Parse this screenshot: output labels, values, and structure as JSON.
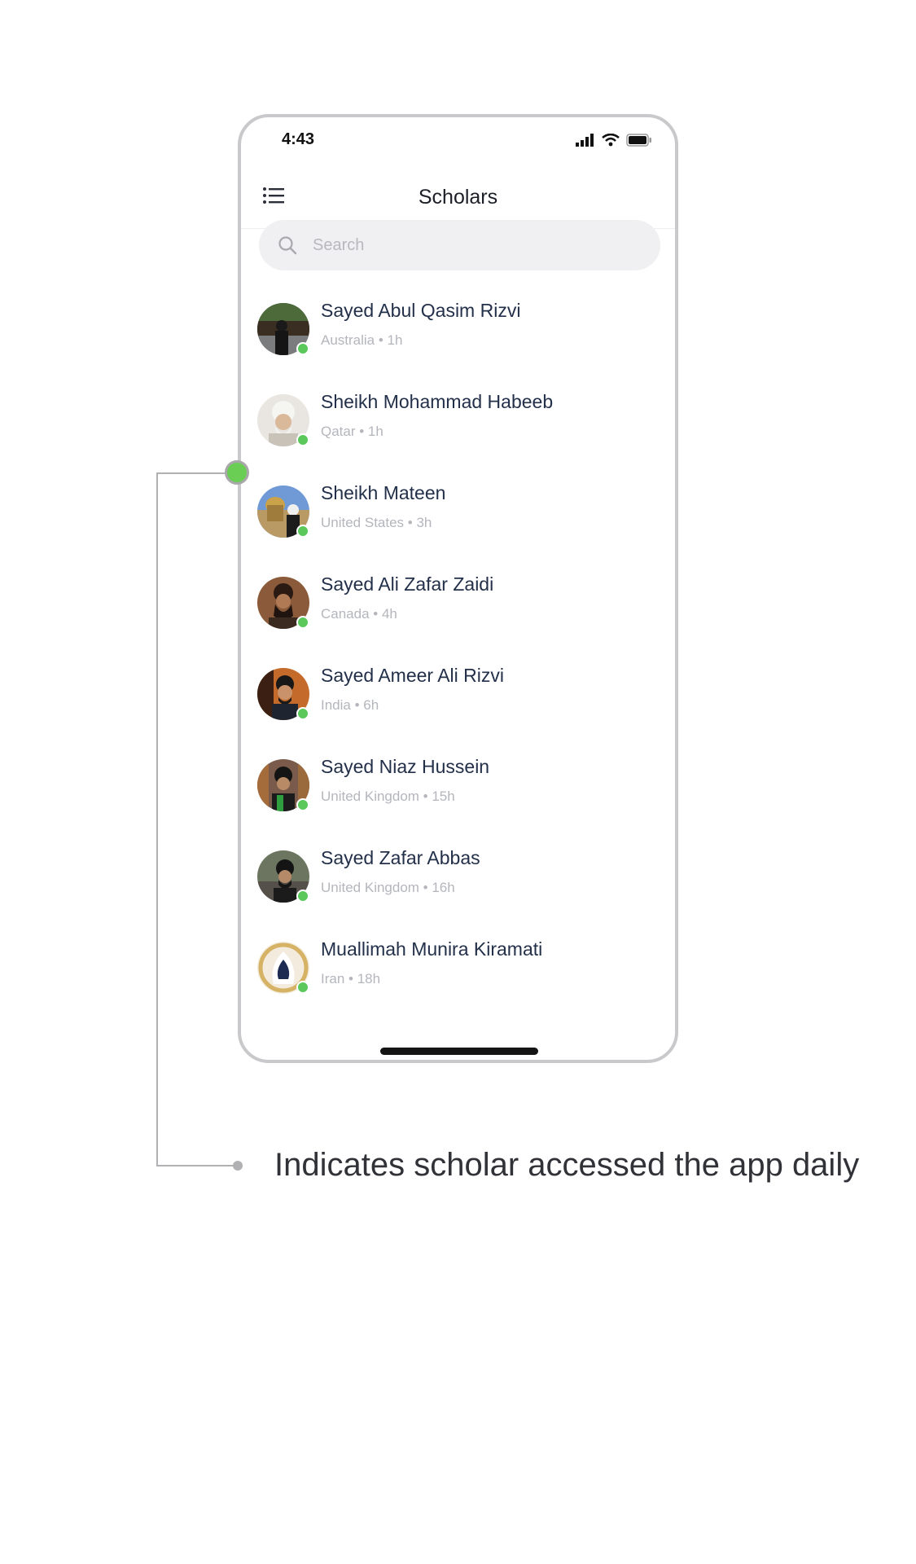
{
  "status_bar": {
    "time": "4:43"
  },
  "nav": {
    "title": "Scholars"
  },
  "search": {
    "placeholder": "Search"
  },
  "scholars": [
    {
      "name": "Sayed Abul Qasim Rizvi",
      "meta": "Australia • 1h"
    },
    {
      "name": "Sheikh Mohammad Habeeb",
      "meta": "Qatar • 1h"
    },
    {
      "name": "Sheikh Mateen",
      "meta": "United States • 3h"
    },
    {
      "name": "Sayed Ali Zafar Zaidi",
      "meta": "Canada • 4h"
    },
    {
      "name": "Sayed Ameer Ali Rizvi",
      "meta": "India • 6h"
    },
    {
      "name": "Sayed Niaz Hussein",
      "meta": "United Kingdom • 15h"
    },
    {
      "name": "Sayed Zafar Abbas",
      "meta": "United Kingdom • 16h"
    },
    {
      "name": "Muallimah Munira Kiramati",
      "meta": "Iran • 18h"
    }
  ],
  "annotation": {
    "text": "Indicates scholar accessed the app daily"
  },
  "colors": {
    "presence": "#5ac85a",
    "callout_marker": "#6ace54"
  }
}
